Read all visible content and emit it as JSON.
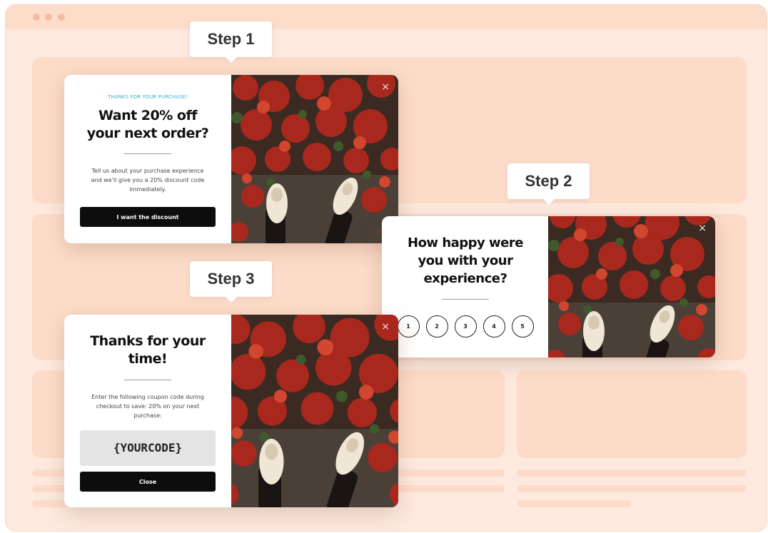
{
  "browser": {
    "window_dots": [
      "red-dot",
      "yellow-dot",
      "green-dot"
    ]
  },
  "steps": {
    "step1": "Step 1",
    "step2": "Step 2",
    "step3": "Step 3"
  },
  "popup1": {
    "eyebrow": "THANKS FOR YOUR PURCHASE!",
    "headline_line1": "Want 20% off",
    "headline_line2": "your next order?",
    "body_line1": "Tell us about your purchase experience",
    "body_line2": "and we'll give you a 20% discount code",
    "body_line3": "immediately.",
    "button": "I want the discount",
    "close": "×"
  },
  "popup2": {
    "headline_line1": "How happy were",
    "headline_line2": "you with your",
    "headline_line3": "experience?",
    "ratings": [
      "1",
      "2",
      "3",
      "4",
      "5"
    ],
    "close": "×"
  },
  "popup3": {
    "headline_line1": "Thanks for your",
    "headline_line2": "time!",
    "body_line1": "Enter the following coupon code during",
    "body_line2": "checkout to save: 20% on your next",
    "body_line3": "purchase:",
    "code": "{YOURCODE}",
    "button": "Close",
    "close": "×"
  },
  "colors": {
    "background": "#fde9de",
    "placeholder": "#fcdcc9",
    "eyebrow": "#43b0c8",
    "button": "#0d0d0d",
    "leaves": "#a8281e",
    "shoe": "#efe6d6"
  },
  "image_description_icon": "autumn-leaves-sneakers-photo"
}
